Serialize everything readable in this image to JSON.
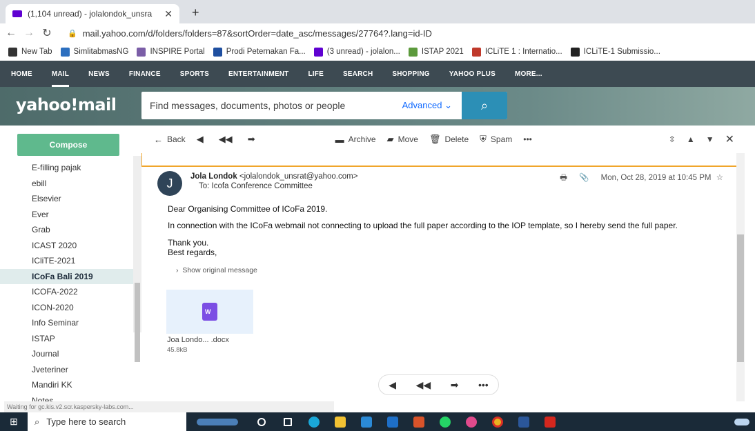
{
  "browser": {
    "tab_title": "(1,104 unread) - jolalondok_unsra",
    "url": "mail.yahoo.com/d/folders/folders=87&sortOrder=date_asc/messages/27764?.lang=id-ID",
    "bookmarks": [
      {
        "label": "New Tab",
        "color": "#333333"
      },
      {
        "label": "SimlitabmasNG",
        "color": "#2c6fbf"
      },
      {
        "label": "INSPIRE Portal",
        "color": "#7b5ea7"
      },
      {
        "label": "Prodi Peternakan Fa...",
        "color": "#1f4fa0"
      },
      {
        "label": "(3 unread) - jolalon...",
        "color": "#5f01d1"
      },
      {
        "label": "ISTAP 2021",
        "color": "#5c9a3c"
      },
      {
        "label": "ICLiTE 1 : Internatio...",
        "color": "#c0392b"
      },
      {
        "label": "ICLiTE-1 Submissio...",
        "color": "#222222"
      }
    ]
  },
  "ynav": [
    "HOME",
    "MAIL",
    "NEWS",
    "FINANCE",
    "SPORTS",
    "ENTERTAINMENT",
    "LIFE",
    "SEARCH",
    "SHOPPING",
    "YAHOO PLUS",
    "MORE..."
  ],
  "header": {
    "logo": "yahoo!mail",
    "search_placeholder": "Find messages, documents, photos or people",
    "advanced": "Advanced"
  },
  "sidebar": {
    "compose": "Compose",
    "folders": [
      "E-filling pajak",
      "ebill",
      "Elsevier",
      "Ever",
      "Grab",
      "ICAST 2020",
      "ICliTE-2021",
      "ICoFa Bali 2019",
      "ICOFA-2022",
      "ICON-2020",
      "Info Seminar",
      "ISTAP",
      "Journal",
      "Jveteriner",
      "Mandiri KK",
      "Notes"
    ],
    "selected": "ICoFa Bali 2019"
  },
  "toolbar": {
    "back": "Back",
    "archive": "Archive",
    "move": "Move",
    "delete": "Delete",
    "spam": "Spam"
  },
  "message": {
    "avatar": "J",
    "sender_name": "Jola Londok",
    "sender_email": "<jolalondok_unsrat@yahoo.com>",
    "to": "To: Icofa Conference Committee",
    "date": "Mon, Oct 28, 2019 at 10:45 PM",
    "greeting": "Dear Organising Committee of ICoFa 2019.",
    "body": "In connection with the ICoFa webmail not connecting to upload the full paper according to the IOP template, so I hereby send the full paper.",
    "thanks": "Thank you.",
    "regards": "Best regards,",
    "show_original": "Show original message",
    "attachment_name": "Joa Londo... .docx",
    "attachment_size": "45.8kB"
  },
  "status_text": "Waiting for gc.kis.v2.scr.kaspersky-labs.com...",
  "taskbar": {
    "search": "Type here to search"
  }
}
